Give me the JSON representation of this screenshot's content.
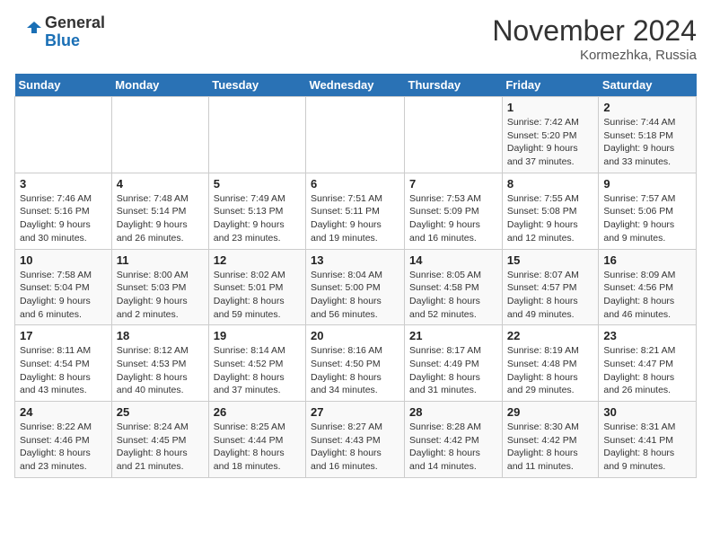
{
  "header": {
    "logo_general": "General",
    "logo_blue": "Blue",
    "month_title": "November 2024",
    "location": "Kormezhka, Russia"
  },
  "weekdays": [
    "Sunday",
    "Monday",
    "Tuesday",
    "Wednesday",
    "Thursday",
    "Friday",
    "Saturday"
  ],
  "weeks": [
    [
      {
        "day": "",
        "info": ""
      },
      {
        "day": "",
        "info": ""
      },
      {
        "day": "",
        "info": ""
      },
      {
        "day": "",
        "info": ""
      },
      {
        "day": "",
        "info": ""
      },
      {
        "day": "1",
        "info": "Sunrise: 7:42 AM\nSunset: 5:20 PM\nDaylight: 9 hours\nand 37 minutes."
      },
      {
        "day": "2",
        "info": "Sunrise: 7:44 AM\nSunset: 5:18 PM\nDaylight: 9 hours\nand 33 minutes."
      }
    ],
    [
      {
        "day": "3",
        "info": "Sunrise: 7:46 AM\nSunset: 5:16 PM\nDaylight: 9 hours\nand 30 minutes."
      },
      {
        "day": "4",
        "info": "Sunrise: 7:48 AM\nSunset: 5:14 PM\nDaylight: 9 hours\nand 26 minutes."
      },
      {
        "day": "5",
        "info": "Sunrise: 7:49 AM\nSunset: 5:13 PM\nDaylight: 9 hours\nand 23 minutes."
      },
      {
        "day": "6",
        "info": "Sunrise: 7:51 AM\nSunset: 5:11 PM\nDaylight: 9 hours\nand 19 minutes."
      },
      {
        "day": "7",
        "info": "Sunrise: 7:53 AM\nSunset: 5:09 PM\nDaylight: 9 hours\nand 16 minutes."
      },
      {
        "day": "8",
        "info": "Sunrise: 7:55 AM\nSunset: 5:08 PM\nDaylight: 9 hours\nand 12 minutes."
      },
      {
        "day": "9",
        "info": "Sunrise: 7:57 AM\nSunset: 5:06 PM\nDaylight: 9 hours\nand 9 minutes."
      }
    ],
    [
      {
        "day": "10",
        "info": "Sunrise: 7:58 AM\nSunset: 5:04 PM\nDaylight: 9 hours\nand 6 minutes."
      },
      {
        "day": "11",
        "info": "Sunrise: 8:00 AM\nSunset: 5:03 PM\nDaylight: 9 hours\nand 2 minutes."
      },
      {
        "day": "12",
        "info": "Sunrise: 8:02 AM\nSunset: 5:01 PM\nDaylight: 8 hours\nand 59 minutes."
      },
      {
        "day": "13",
        "info": "Sunrise: 8:04 AM\nSunset: 5:00 PM\nDaylight: 8 hours\nand 56 minutes."
      },
      {
        "day": "14",
        "info": "Sunrise: 8:05 AM\nSunset: 4:58 PM\nDaylight: 8 hours\nand 52 minutes."
      },
      {
        "day": "15",
        "info": "Sunrise: 8:07 AM\nSunset: 4:57 PM\nDaylight: 8 hours\nand 49 minutes."
      },
      {
        "day": "16",
        "info": "Sunrise: 8:09 AM\nSunset: 4:56 PM\nDaylight: 8 hours\nand 46 minutes."
      }
    ],
    [
      {
        "day": "17",
        "info": "Sunrise: 8:11 AM\nSunset: 4:54 PM\nDaylight: 8 hours\nand 43 minutes."
      },
      {
        "day": "18",
        "info": "Sunrise: 8:12 AM\nSunset: 4:53 PM\nDaylight: 8 hours\nand 40 minutes."
      },
      {
        "day": "19",
        "info": "Sunrise: 8:14 AM\nSunset: 4:52 PM\nDaylight: 8 hours\nand 37 minutes."
      },
      {
        "day": "20",
        "info": "Sunrise: 8:16 AM\nSunset: 4:50 PM\nDaylight: 8 hours\nand 34 minutes."
      },
      {
        "day": "21",
        "info": "Sunrise: 8:17 AM\nSunset: 4:49 PM\nDaylight: 8 hours\nand 31 minutes."
      },
      {
        "day": "22",
        "info": "Sunrise: 8:19 AM\nSunset: 4:48 PM\nDaylight: 8 hours\nand 29 minutes."
      },
      {
        "day": "23",
        "info": "Sunrise: 8:21 AM\nSunset: 4:47 PM\nDaylight: 8 hours\nand 26 minutes."
      }
    ],
    [
      {
        "day": "24",
        "info": "Sunrise: 8:22 AM\nSunset: 4:46 PM\nDaylight: 8 hours\nand 23 minutes."
      },
      {
        "day": "25",
        "info": "Sunrise: 8:24 AM\nSunset: 4:45 PM\nDaylight: 8 hours\nand 21 minutes."
      },
      {
        "day": "26",
        "info": "Sunrise: 8:25 AM\nSunset: 4:44 PM\nDaylight: 8 hours\nand 18 minutes."
      },
      {
        "day": "27",
        "info": "Sunrise: 8:27 AM\nSunset: 4:43 PM\nDaylight: 8 hours\nand 16 minutes."
      },
      {
        "day": "28",
        "info": "Sunrise: 8:28 AM\nSunset: 4:42 PM\nDaylight: 8 hours\nand 14 minutes."
      },
      {
        "day": "29",
        "info": "Sunrise: 8:30 AM\nSunset: 4:42 PM\nDaylight: 8 hours\nand 11 minutes."
      },
      {
        "day": "30",
        "info": "Sunrise: 8:31 AM\nSunset: 4:41 PM\nDaylight: 8 hours\nand 9 minutes."
      }
    ]
  ]
}
